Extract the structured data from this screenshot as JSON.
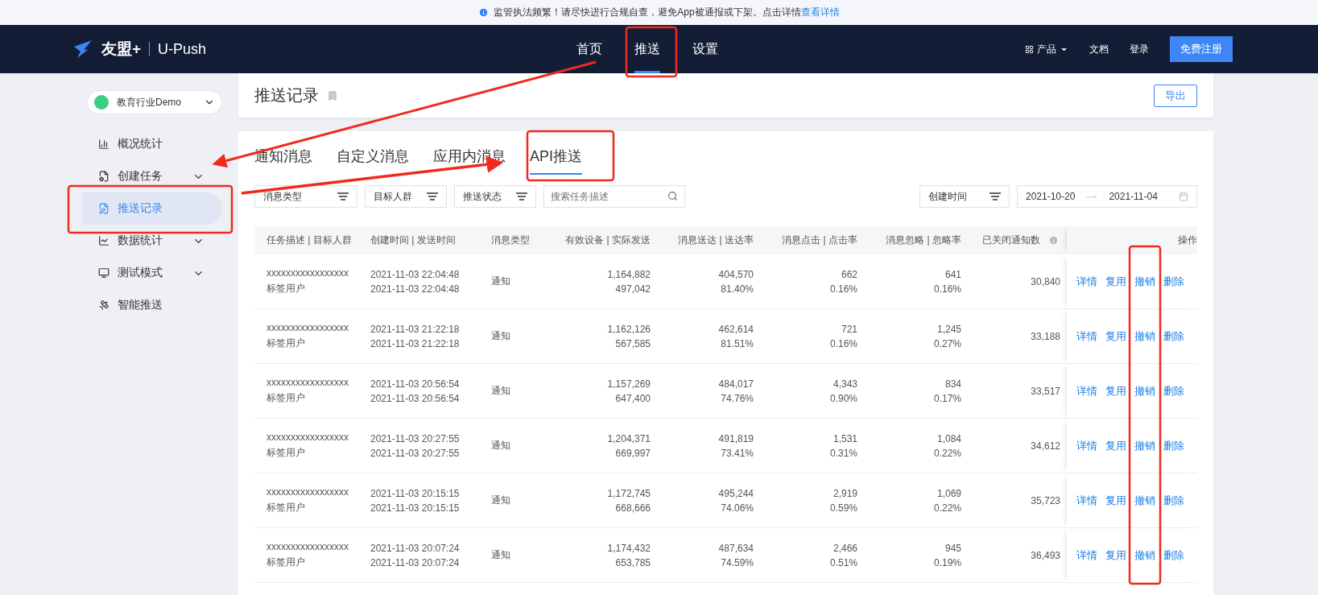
{
  "notice": {
    "text": "监管执法频繁！请尽快进行合规自查，避免App被通报或下架。点击详情",
    "link": "查看详情"
  },
  "nav": {
    "brand": "友盟+",
    "product": "U-Push",
    "items": [
      {
        "label": "首页",
        "selected": false
      },
      {
        "label": "推送",
        "selected": true
      },
      {
        "label": "设置",
        "selected": false
      }
    ],
    "products": "产品",
    "docs": "文档",
    "login": "登录",
    "signup": "免费注册"
  },
  "app_selector": "教育行业Demo",
  "sidebar": {
    "items": [
      {
        "label": "概况统计",
        "selected": false,
        "has_submenu": false
      },
      {
        "label": "创建任务",
        "selected": false,
        "has_submenu": true
      },
      {
        "label": "推送记录",
        "selected": true,
        "has_submenu": false
      },
      {
        "label": "数据统计",
        "selected": false,
        "has_submenu": true
      },
      {
        "label": "测试模式",
        "selected": false,
        "has_submenu": true
      },
      {
        "label": "智能推送",
        "selected": false,
        "has_submenu": false
      }
    ]
  },
  "page_title": "推送记录",
  "export_button": "导出",
  "tabs": [
    {
      "label": "通知消息",
      "selected": false
    },
    {
      "label": "自定义消息",
      "selected": false
    },
    {
      "label": "应用内消息",
      "selected": false
    },
    {
      "label": "API推送",
      "selected": true
    }
  ],
  "filters": [
    "消息类型",
    "目标人群",
    "推送状态"
  ],
  "search": {
    "placeholder": "搜索任务描述"
  },
  "time_filter": "创建时间",
  "date_range": {
    "start": "2021-10-20",
    "end": "2021-11-04"
  },
  "table": {
    "columns": [
      "任务描述 | 目标人群",
      "创建时间 | 发送时间",
      "消息类型",
      "有效设备 | 实际发送",
      "消息送达 | 送达率",
      "消息点击 | 点击率",
      "消息忽略 | 忽略率",
      "已关闭通知数",
      "操作"
    ],
    "rows": [
      {
        "desc": "xxxxxxxxxxxxxxxxx",
        "audience": "标签用户",
        "created": "2021-11-03 22:04:48",
        "sent": "2021-11-03 22:04:48",
        "type": "通知",
        "devices": "1,164,882",
        "actual": "497,042",
        "delivered": "404,570",
        "delivered_rate": "81.40%",
        "clicks": "662",
        "click_rate": "0.16%",
        "ignored": "641",
        "ignore_rate": "0.16%",
        "closed": "30,840",
        "actions": [
          "详情",
          "复用",
          "撤销",
          "删除"
        ]
      },
      {
        "desc": "xxxxxxxxxxxxxxxxx",
        "audience": "标签用户",
        "created": "2021-11-03 21:22:18",
        "sent": "2021-11-03 21:22:18",
        "type": "通知",
        "devices": "1,162,126",
        "actual": "567,585",
        "delivered": "462,614",
        "delivered_rate": "81.51%",
        "clicks": "721",
        "click_rate": "0.16%",
        "ignored": "1,245",
        "ignore_rate": "0.27%",
        "closed": "33,188",
        "actions": [
          "详情",
          "复用",
          "撤销",
          "删除"
        ]
      },
      {
        "desc": "xxxxxxxxxxxxxxxxx",
        "audience": "标签用户",
        "created": "2021-11-03 20:56:54",
        "sent": "2021-11-03 20:56:54",
        "type": "通知",
        "devices": "1,157,269",
        "actual": "647,400",
        "delivered": "484,017",
        "delivered_rate": "74.76%",
        "clicks": "4,343",
        "click_rate": "0.90%",
        "ignored": "834",
        "ignore_rate": "0.17%",
        "closed": "33,517",
        "actions": [
          "详情",
          "复用",
          "撤销",
          "删除"
        ]
      },
      {
        "desc": "xxxxxxxxxxxxxxxxx",
        "audience": "标签用户",
        "created": "2021-11-03 20:27:55",
        "sent": "2021-11-03 20:27:55",
        "type": "通知",
        "devices": "1,204,371",
        "actual": "669,997",
        "delivered": "491,819",
        "delivered_rate": "73.41%",
        "clicks": "1,531",
        "click_rate": "0.31%",
        "ignored": "1,084",
        "ignore_rate": "0.22%",
        "closed": "34,612",
        "actions": [
          "详情",
          "复用",
          "撤销",
          "删除"
        ]
      },
      {
        "desc": "xxxxxxxxxxxxxxxxx",
        "audience": "标签用户",
        "created": "2021-11-03 20:15:15",
        "sent": "2021-11-03 20:15:15",
        "type": "通知",
        "devices": "1,172,745",
        "actual": "668,666",
        "delivered": "495,244",
        "delivered_rate": "74.06%",
        "clicks": "2,919",
        "click_rate": "0.59%",
        "ignored": "1,069",
        "ignore_rate": "0.22%",
        "closed": "35,723",
        "actions": [
          "详情",
          "复用",
          "撤销",
          "删除"
        ]
      },
      {
        "desc": "xxxxxxxxxxxxxxxxx",
        "audience": "标签用户",
        "created": "2021-11-03 20:07:24",
        "sent": "2021-11-03 20:07:24",
        "type": "通知",
        "devices": "1,174,432",
        "actual": "653,785",
        "delivered": "487,634",
        "delivered_rate": "74.59%",
        "clicks": "2,466",
        "click_rate": "0.51%",
        "ignored": "945",
        "ignore_rate": "0.19%",
        "closed": "36,493",
        "actions": [
          "详情",
          "复用",
          "撤销",
          "删除"
        ]
      }
    ]
  }
}
